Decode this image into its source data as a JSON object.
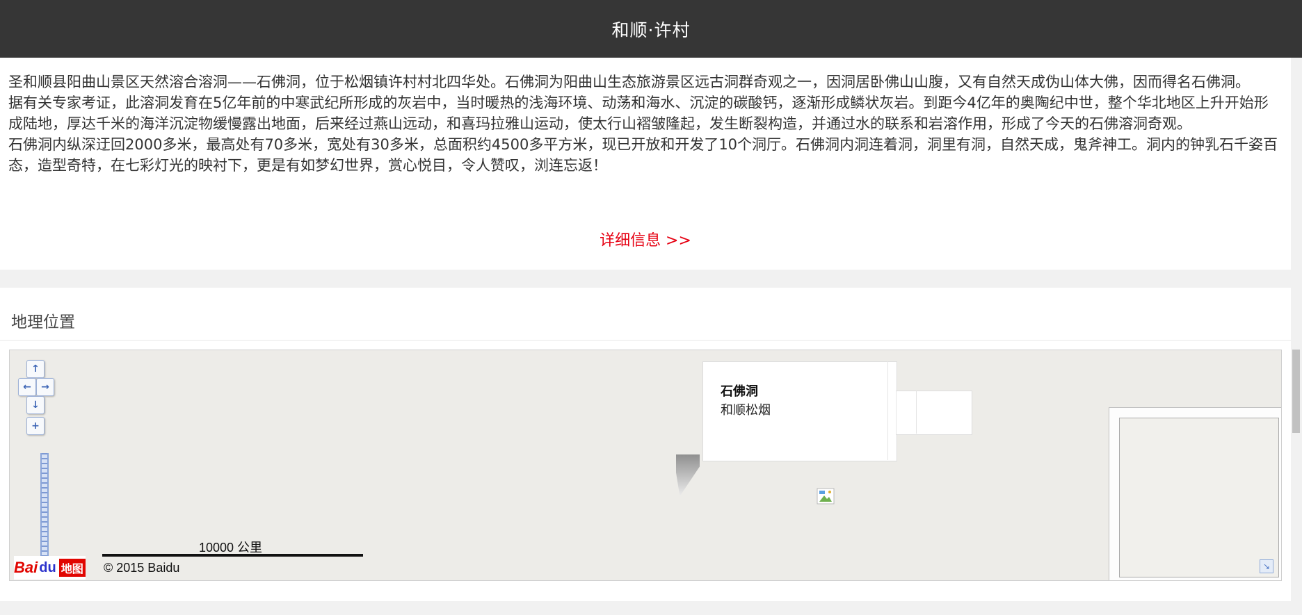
{
  "header": {
    "title": "和顺·许村"
  },
  "description": {
    "paragraphs": [
      "圣和顺县阳曲山景区天然溶合溶洞——石佛洞，位于松烟镇许村村北四华处。石佛洞为阳曲山生态旅游景区远古洞群奇观之一，因洞居卧佛山山腹，又有自然天成伪山体大佛，因而得名石佛洞。",
      "据有关专家考证，此溶洞发育在5亿年前的中寒武纪所形成的灰岩中，当时暖热的浅海环境、动荡和海水、沉淀的碳酸钙，逐渐形成鳞状灰岩。到距今4亿年的奥陶纪中世，整个华北地区上升开始形成陆地，厚达千米的海洋沉淀物缓慢露出地面，后来经过燕山远动，和喜玛拉雅山运动，使太行山褶皱隆起，发生断裂构造，并通过水的联系和岩溶作用，形成了今天的石佛溶洞奇观。",
      "石佛洞内纵深迂回2000多米，最高处有70多米，宽处有30多米，总面积约4500多平方米，现已开放和开发了10个洞厅。石佛洞内洞连着洞，洞里有洞，自然天成，鬼斧神工。洞内的钟乳石千姿百态，造型奇特，在七彩灯光的映衬下，更是有如梦幻世界，赏心悦目，令人赞叹，浏连忘返！"
    ],
    "more_link": "详细信息 >>"
  },
  "location": {
    "title": "地理位置",
    "map": {
      "pan_up": "↑",
      "pan_left": "←",
      "pan_right": "→",
      "pan_down": "↓",
      "zoom_in": "+",
      "info_name": "石佛洞",
      "info_address": "和顺松烟",
      "scale_label": "10000 公里",
      "copyright": "© 2015 Baidu",
      "logo_bai": "Bai",
      "logo_du": "du",
      "logo_map": "地图",
      "overview_toggle": "↘"
    }
  },
  "colors": {
    "header_bg": "#363636",
    "link": "#e60012",
    "map_bg": "#edece8"
  }
}
